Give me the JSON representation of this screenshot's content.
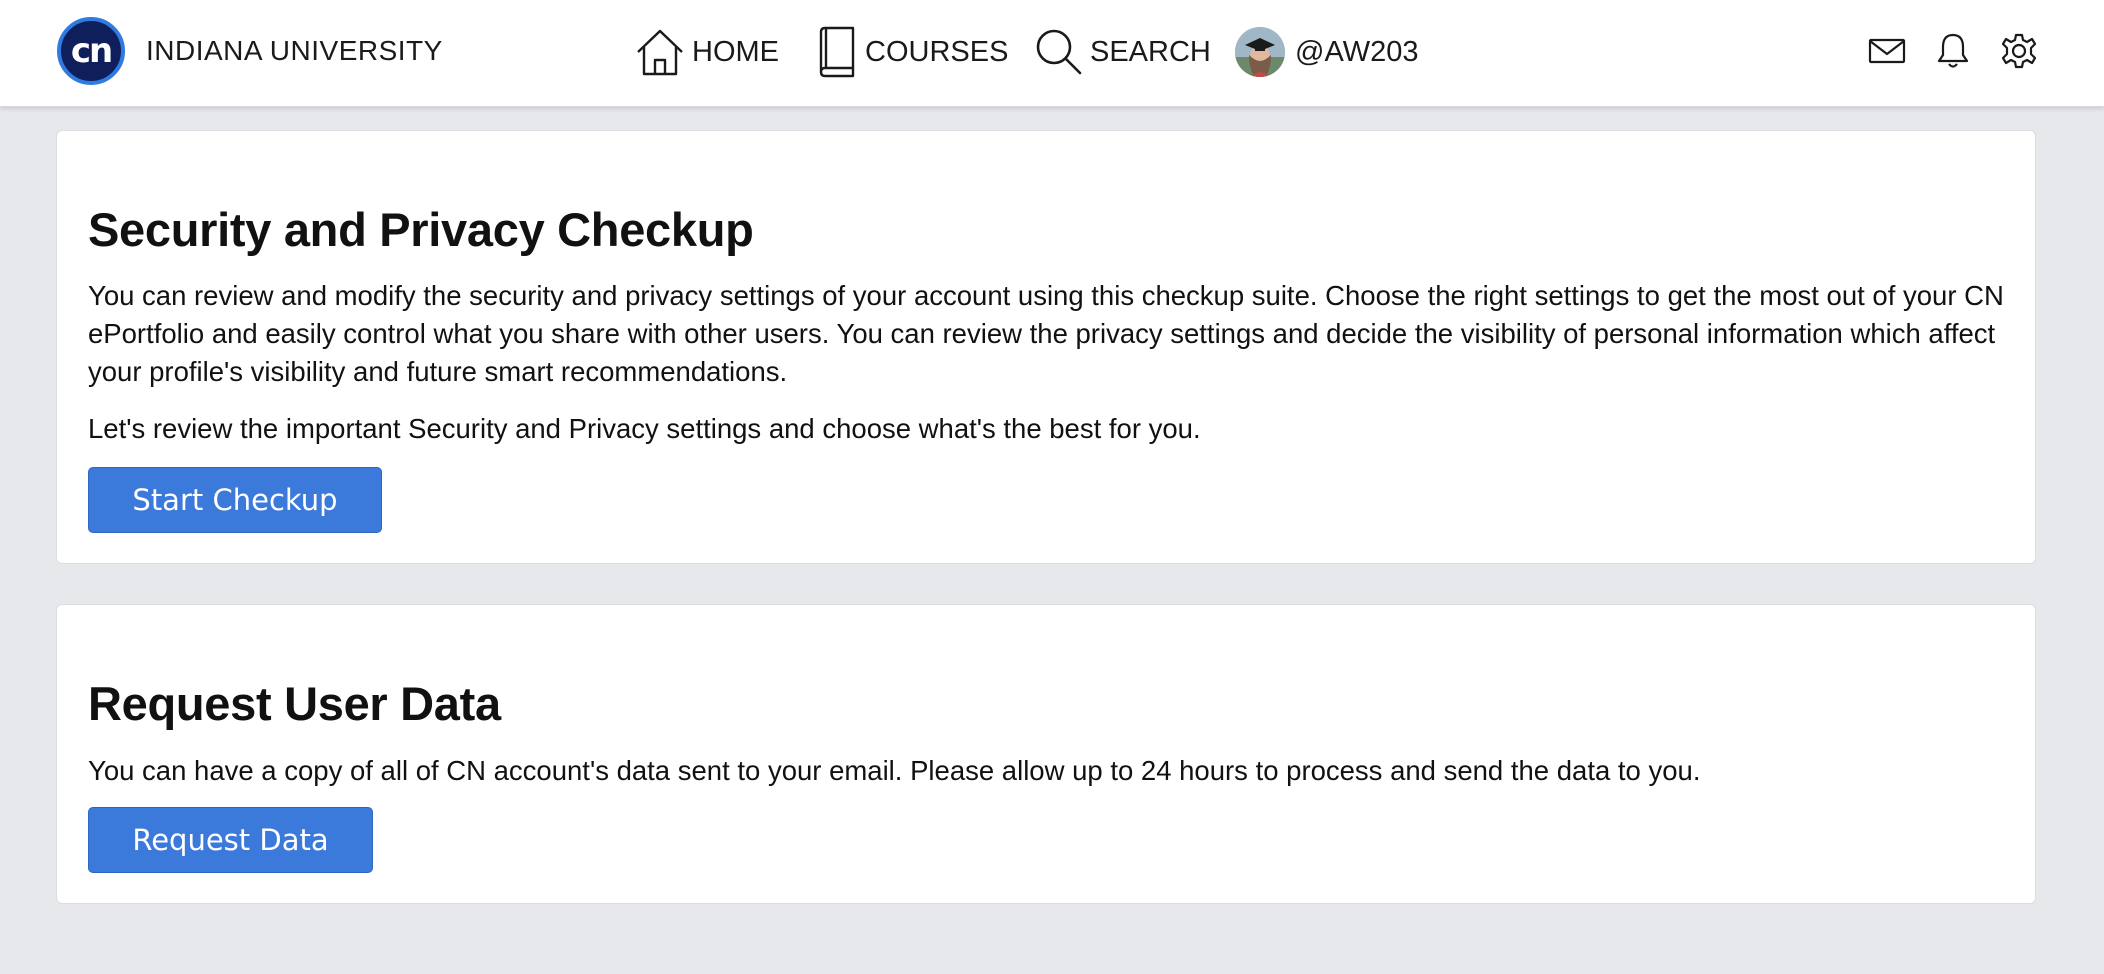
{
  "header": {
    "logo_text": "cn",
    "brand": "INDIANA UNIVERSITY",
    "nav": {
      "home": "HOME",
      "courses": "COURSES",
      "search": "SEARCH",
      "user": "@AW203"
    },
    "icons": [
      "home-icon",
      "book-icon",
      "search-icon",
      "avatar",
      "mail-icon",
      "bell-icon",
      "gear-icon"
    ]
  },
  "security": {
    "title": "Security and Privacy Checkup",
    "description": "You can review and modify the security and privacy settings of your account using this checkup suite. Choose the right settings to get the most out of your CN ePortfolio and easily control what you share with other users. You can review the privacy settings and decide the visibility of personal information which affect your profile's visibility and future smart recommendations.",
    "prompt": "Let's review the important Security and Privacy settings and choose what's the best for you.",
    "button": "Start Checkup"
  },
  "request": {
    "title": "Request User Data",
    "description": "You can have a copy of all of CN account's data sent to your email. Please allow up to 24 hours to process and send the data to you.",
    "button": "Request Data"
  },
  "colors": {
    "accent": "#3b79db",
    "page_bg": "#e7e8eb",
    "logo_bg": "#0e1f5c"
  }
}
